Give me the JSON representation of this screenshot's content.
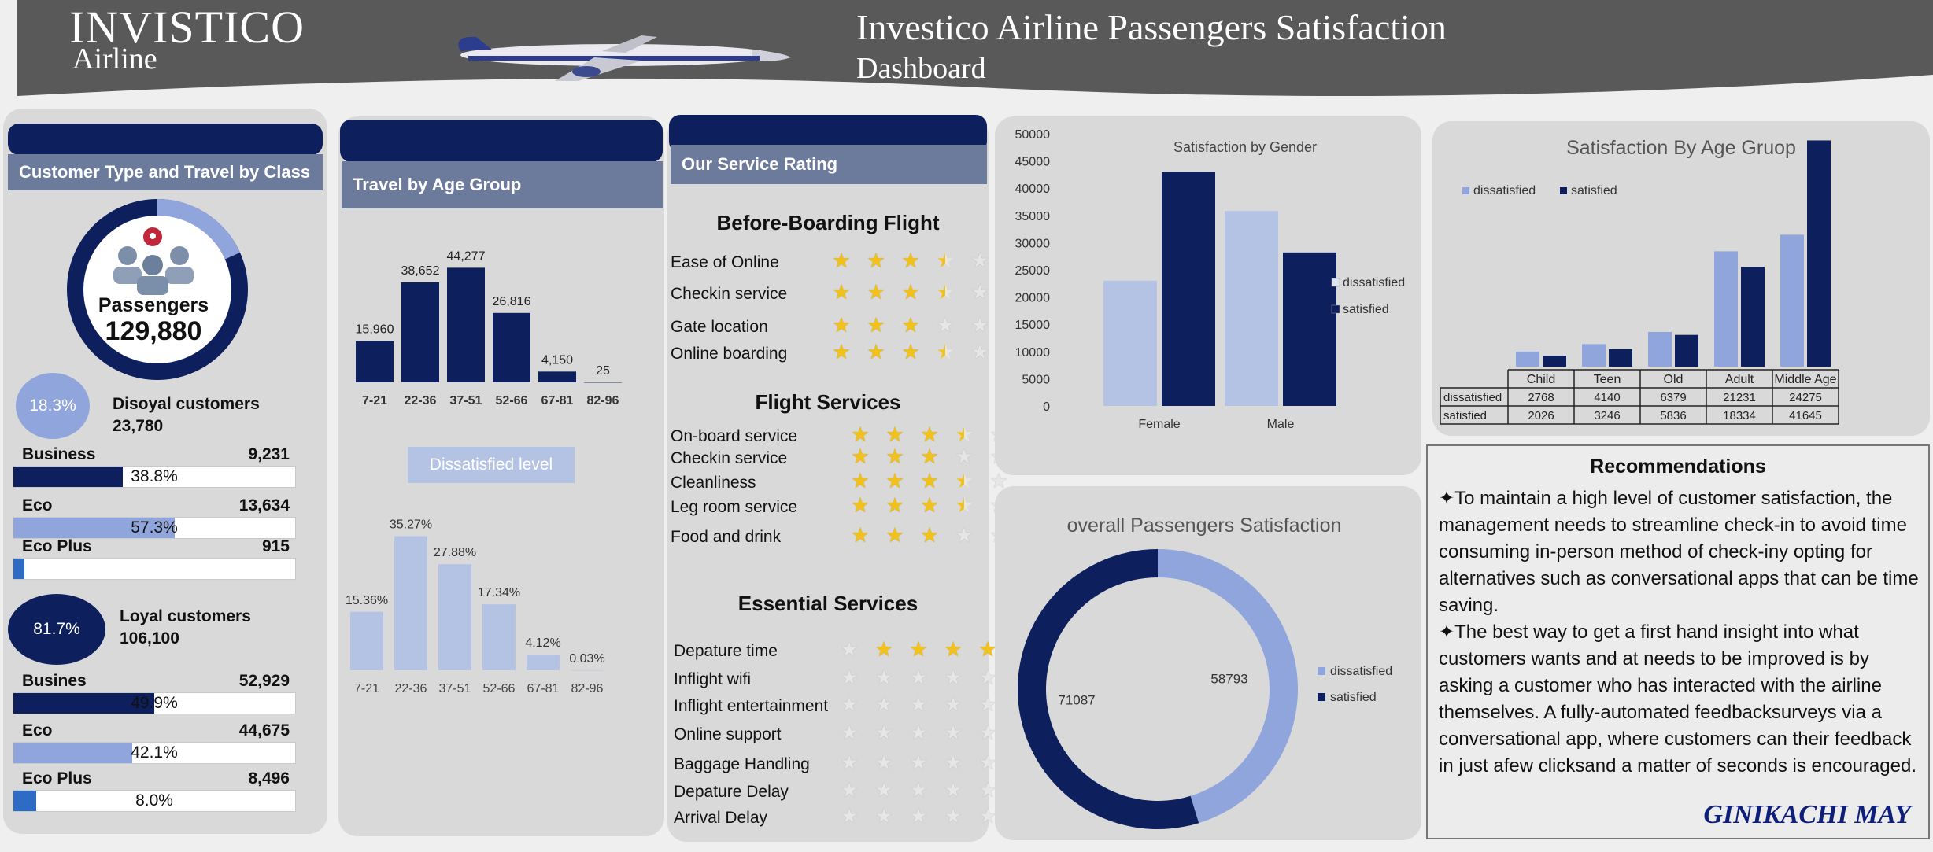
{
  "header": {
    "brand_name": "INVISTICO",
    "brand_sub": "Airline",
    "title": "Investico Airline Passengers Satisfaction",
    "subtitle": "Dashboard"
  },
  "customer_panel": {
    "title": "Customer Type and Travel by Class",
    "ring_label": "Passengers",
    "ring_value": "129,880",
    "ring_share": 0.183,
    "disloyal": {
      "pct": "18.3%",
      "label": "Disoyal customers",
      "count": "23,780",
      "classes": [
        {
          "name": "Business",
          "count": "9,231",
          "pct": "38.8%",
          "fill": 0.388,
          "color": "#0d1f5c"
        },
        {
          "name": "Eco",
          "count": "13,634",
          "pct": "57.3%",
          "fill": 0.573,
          "color": "#8fa5dc"
        },
        {
          "name": "Eco Plus",
          "count": "915",
          "pct": "",
          "fill": 0.04,
          "color": "#2e6bc4"
        }
      ]
    },
    "loyal": {
      "pct": "81.7%",
      "label": "Loyal customers",
      "count": "106,100",
      "classes": [
        {
          "name": "Busines",
          "count": "52,929",
          "pct": "49.9%",
          "fill": 0.499,
          "color": "#0d1f5c"
        },
        {
          "name": "Eco",
          "count": "44,675",
          "pct": "42.1%",
          "fill": 0.421,
          "color": "#8fa5dc"
        },
        {
          "name": "Eco Plus",
          "count": "8,496",
          "pct": "8.0%",
          "fill": 0.08,
          "color": "#2e6bc4"
        }
      ]
    }
  },
  "age_panel": {
    "title": "Travel by Age Group",
    "dissatisfied_label": "Dissatisfied level"
  },
  "service_panel": {
    "title": "Our Service Rating",
    "sections": [
      {
        "heading": "Before-Boarding Flight",
        "items": [
          {
            "name": "Ease of Online",
            "rating": 3.5
          },
          {
            "name": "Checkin service",
            "rating": 3.5
          },
          {
            "name": "Gate location",
            "rating": 3
          },
          {
            "name": "Online boarding",
            "rating": 3.5
          }
        ]
      },
      {
        "heading": "Flight Services",
        "items": [
          {
            "name": "On-board service",
            "rating": 3.5
          },
          {
            "name": "Checkin service",
            "rating": 3
          },
          {
            "name": "Cleanliness",
            "rating": 3.5
          },
          {
            "name": "Leg room service",
            "rating": 3.5
          },
          {
            "name": "Food and drink",
            "rating": 3
          }
        ]
      },
      {
        "heading": "Essential Services",
        "items": [
          {
            "name": "Depature time",
            "rating": 4,
            "empty_first": true
          },
          {
            "name": "Inflight wifi",
            "rating": 0
          },
          {
            "name": "Inflight entertainment",
            "rating": 0
          },
          {
            "name": "Online support",
            "rating": 0
          },
          {
            "name": "Baggage Handling",
            "rating": 0
          },
          {
            "name": "Depature Delay",
            "rating": 0
          },
          {
            "name": "Arrival Delay",
            "rating": 0
          }
        ]
      }
    ]
  },
  "recommendations": {
    "title": "Recommendations",
    "p1": "✦To maintain a high level of customer satisfaction, the management needs to streamline check-in to avoid time consuming in-person method of check-iny opting for alternatives such as conversational apps that can be time saving.",
    "p2": "✦The best way to get a first hand insight into what customers wants and at needs to be improved is by asking a customer who has interacted with the airline themselves. A fully-automated feedbacksurveys via a conversational app, where customers can  their feedback in just afew clicksand a matter of seconds is encouraged.",
    "author": "GINIKACHI MAY"
  },
  "colors": {
    "navy": "#0d1f5c",
    "light": "#b4c2e3",
    "mid": "#8fa5dc",
    "panel": "#d9d9d9"
  },
  "chart_data": [
    {
      "type": "bar",
      "id": "travel_by_age",
      "categories": [
        "7-21",
        "22-36",
        "37-51",
        "52-66",
        "67-81",
        "82-96"
      ],
      "values": [
        15960,
        38652,
        44277,
        26816,
        4150,
        25
      ],
      "labels": [
        "15,960",
        "38,652",
        "44,277",
        "26,816",
        "4,150",
        "25"
      ],
      "ylim": [
        0,
        45000
      ]
    },
    {
      "type": "bar",
      "id": "dissatisfied_level",
      "categories": [
        "7-21",
        "22-36",
        "37-51",
        "52-66",
        "67-81",
        "82-96"
      ],
      "values": [
        15.36,
        35.27,
        27.88,
        17.34,
        4.12,
        0.03
      ],
      "labels": [
        "15.36%",
        "35.27%",
        "27.88%",
        "17.34%",
        "4.12%",
        "0.03%"
      ],
      "ylim": [
        0,
        36
      ]
    },
    {
      "type": "bar",
      "id": "satisfaction_by_gender",
      "title": "Satisfaction by Gender",
      "categories": [
        "Female",
        "Male"
      ],
      "series": [
        {
          "name": "dissatisfied",
          "values": [
            23000,
            35800
          ]
        },
        {
          "name": "satisfied",
          "values": [
            43000,
            28200
          ]
        }
      ],
      "ylim": [
        0,
        50000
      ],
      "yticks": [
        0,
        5000,
        10000,
        15000,
        20000,
        25000,
        30000,
        35000,
        40000,
        45000,
        50000
      ],
      "legend": "right"
    },
    {
      "type": "bar",
      "id": "satisfaction_by_age_group",
      "title": "Satisfaction By Age Gruop",
      "categories": [
        "Child",
        "Teen",
        "Old",
        "Adult",
        "Middle Age"
      ],
      "series": [
        {
          "name": "dissatisfied",
          "values": [
            2768,
            4140,
            6379,
            21231,
            24275
          ]
        },
        {
          "name": "satisfied",
          "values": [
            2026,
            3246,
            5836,
            18334,
            41645
          ]
        }
      ],
      "ylim": [
        0,
        42000
      ],
      "legend": "top-left",
      "data_table": true
    },
    {
      "type": "pie",
      "id": "overall_satisfaction",
      "title": "overall Passengers Satisfaction",
      "categories": [
        "dissatisfied",
        "satisfied"
      ],
      "values": [
        58793,
        71087
      ],
      "legend": "right"
    }
  ]
}
